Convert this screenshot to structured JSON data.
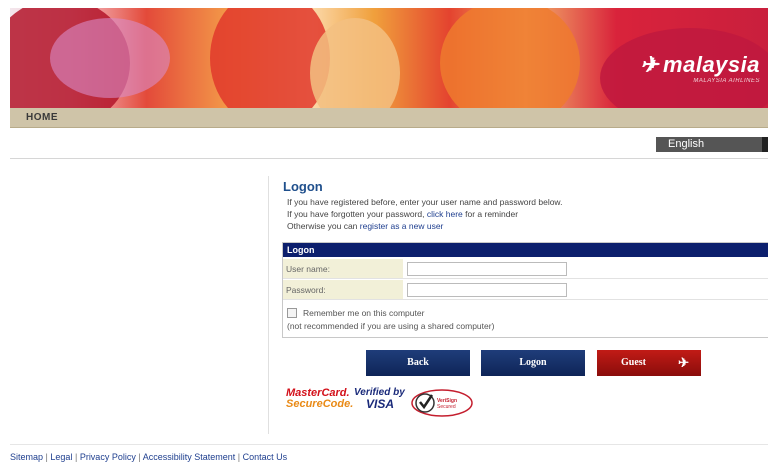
{
  "brand": {
    "logo_text": "malaysia",
    "logo_sub": "MALAYSIA AIRLINES"
  },
  "nav": {
    "home": "HOME"
  },
  "language": {
    "selected": "English"
  },
  "logon": {
    "title": "Logon",
    "intro_line1": "If you have registered before, enter your user name and password below.",
    "intro_line2_prefix": "If you have forgotten your password, ",
    "intro_line2_link": "click here",
    "intro_line2_suffix": " for a reminder",
    "intro_line3_prefix": "Otherwise you can ",
    "intro_line3_link": "register as a new user",
    "panel_title": "Logon",
    "username_label": "User name:",
    "password_label": "Password:",
    "remember_label": "Remember me on this computer",
    "remember_note": "(not recommended if you are using a shared computer)"
  },
  "buttons": {
    "back": "Back",
    "logon": "Logon",
    "guest": "Guest",
    "guest_icon": "plane-icon"
  },
  "badges": {
    "mastercard_a": "MasterCard.",
    "mastercard_b": "SecureCode.",
    "visa_a": "Verified by",
    "visa_b": "VISA",
    "verisign": "VeriSign Secured"
  },
  "footer": {
    "links": [
      "Sitemap",
      "Legal",
      "Privacy Policy",
      "Accessibility Statement",
      "Contact Us"
    ]
  },
  "colors": {
    "navy": "#0c1f6d",
    "red_button": "#c11b16",
    "title_blue": "#1f4f8c"
  }
}
